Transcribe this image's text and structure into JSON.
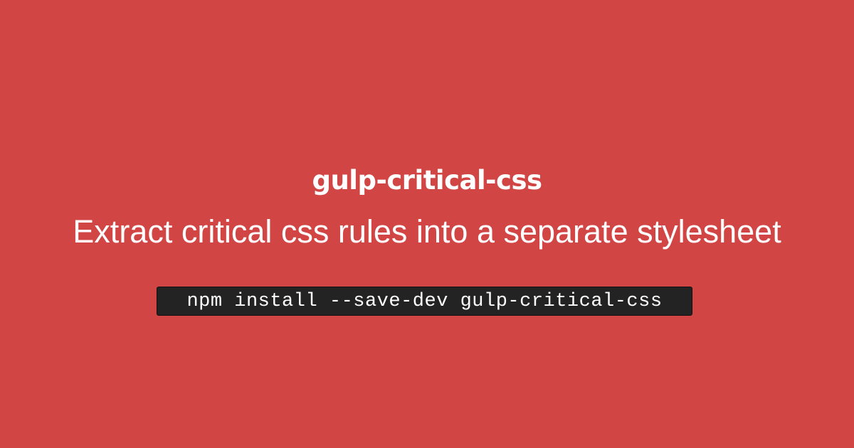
{
  "colors": {
    "background": "#d14644",
    "text": "#ffffff",
    "code_background": "#232323"
  },
  "package": {
    "name": "gulp-critical-css",
    "description": "Extract critical css rules into a separate stylesheet",
    "install_command": "npm install --save-dev gulp-critical-css"
  }
}
